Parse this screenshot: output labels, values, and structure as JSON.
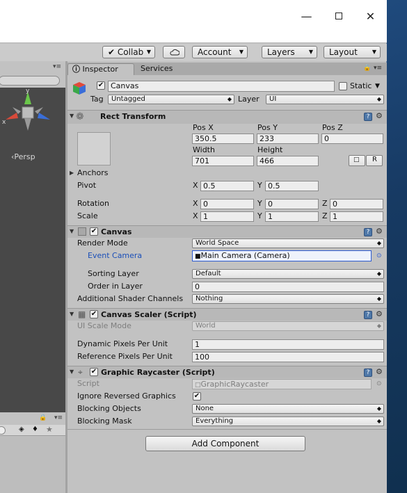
{
  "toolbar": {
    "collab": "Collab",
    "cloud_icon": "cloud-icon",
    "account": "Account",
    "layers": "Layers",
    "layout": "Layout"
  },
  "scene": {
    "persp": "‹Persp",
    "axis_x": "x",
    "axis_y": "y"
  },
  "tabs": {
    "inspector": "Inspector",
    "services": "Services"
  },
  "object": {
    "name": "Canvas",
    "static_label": "Static",
    "tag_label": "Tag",
    "tag_value": "Untagged",
    "layer_label": "Layer",
    "layer_value": "UI"
  },
  "rect": {
    "title": "Rect Transform",
    "posx_label": "Pos X",
    "posy_label": "Pos Y",
    "posz_label": "Pos Z",
    "posx": "350.5",
    "posy": "233",
    "posz": "0",
    "width_label": "Width",
    "height_label": "Height",
    "width": "701",
    "height": "466",
    "anchors": "Anchors",
    "pivot": "Pivot",
    "pivot_x": "0.5",
    "pivot_y": "0.5",
    "rotation": "Rotation",
    "rot_x": "0",
    "rot_y": "0",
    "rot_z": "0",
    "scale": "Scale",
    "scale_x": "1",
    "scale_y": "1",
    "scale_z": "1",
    "x": "X",
    "y": "Y",
    "z": "Z",
    "r_btn": "R"
  },
  "canvas": {
    "title": "Canvas",
    "render_mode_label": "Render Mode",
    "render_mode": "World Space",
    "event_camera_label": "Event Camera",
    "event_camera": "Main Camera (Camera)",
    "sorting_layer_label": "Sorting Layer",
    "sorting_layer": "Default",
    "order_label": "Order in Layer",
    "order": "0",
    "shader_label": "Additional Shader Channels",
    "shader": "Nothing"
  },
  "scaler": {
    "title": "Canvas Scaler (Script)",
    "ui_scale_label": "UI Scale Mode",
    "ui_scale": "World",
    "dpu_label": "Dynamic Pixels Per Unit",
    "dpu": "1",
    "rppu_label": "Reference Pixels Per Unit",
    "rppu": "100"
  },
  "raycaster": {
    "title": "Graphic Raycaster (Script)",
    "script_label": "Script",
    "script": "GraphicRaycaster",
    "ignore_label": "Ignore Reversed Graphics",
    "blocking_objects_label": "Blocking Objects",
    "blocking_objects": "None",
    "blocking_mask_label": "Blocking Mask",
    "blocking_mask": "Everything"
  },
  "add_component": "Add Component",
  "colors": {
    "help_blue": "#4f78a8",
    "desktop": "#1d3f6b",
    "panel": "#c2c2c2",
    "scene": "#484848"
  }
}
